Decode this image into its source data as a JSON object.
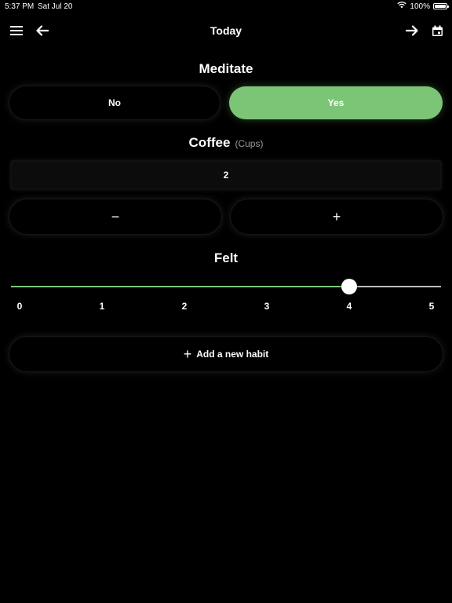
{
  "status_bar": {
    "time": "5:37 PM",
    "date": "Sat Jul 20",
    "battery": "100%"
  },
  "nav": {
    "title": "Today"
  },
  "meditate": {
    "title": "Meditate",
    "no_label": "No",
    "yes_label": "Yes",
    "selected": "Yes"
  },
  "coffee": {
    "title": "Coffee",
    "unit": "(Cups)",
    "value": "2",
    "decrement_label": "−",
    "increment_label": "+"
  },
  "felt": {
    "title": "Felt",
    "min": 0,
    "max": 5,
    "value": 4,
    "ticks": [
      "0",
      "1",
      "2",
      "3",
      "4",
      "5"
    ]
  },
  "add_habit": {
    "label": "Add a new habit",
    "icon": "+"
  },
  "colors": {
    "accent": "#7cc576",
    "background": "#000000"
  }
}
